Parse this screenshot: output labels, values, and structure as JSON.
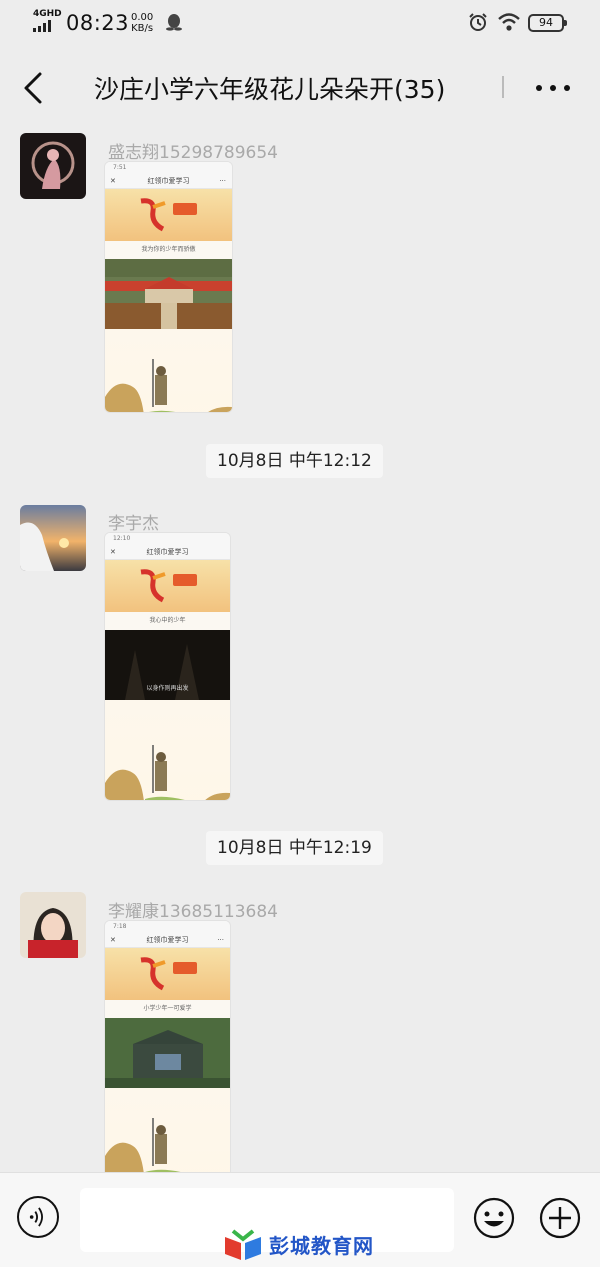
{
  "status_bar": {
    "network": "4GHD",
    "time": "08:23",
    "speed_value": "0.00",
    "speed_unit": "KB/s",
    "battery": "94"
  },
  "header": {
    "title": "沙庄小学六年级花儿朵朵开(35)"
  },
  "messages": [
    {
      "sender": "盛志翔15298789654",
      "screenshot": {
        "time": "7:51",
        "page_title": "红领巾爱学习",
        "subtitle": "我为你的少年而骄傲"
      },
      "scene": "palace"
    },
    {
      "sender": "李宇杰",
      "screenshot": {
        "time": "12:10",
        "page_title": "红领巾爱学习",
        "subtitle": "我心中的少年",
        "video_caption": "以身作则再出发"
      },
      "scene": "dark"
    },
    {
      "sender": "李耀康13685113684",
      "screenshot": {
        "time": "7:18",
        "page_title": "红领巾爱学习",
        "subtitle": "小学少年一可爱学"
      },
      "scene": "aerial"
    }
  ],
  "timestamps": [
    "10月8日 中午12:12",
    "10月8日 中午12:19"
  ],
  "input": {
    "value": ""
  },
  "watermark": {
    "text": "彭城教育网"
  },
  "colors": {
    "background": "#ededed",
    "sender": "#a9a9a9",
    "input_bar": "#f7f7f7"
  }
}
